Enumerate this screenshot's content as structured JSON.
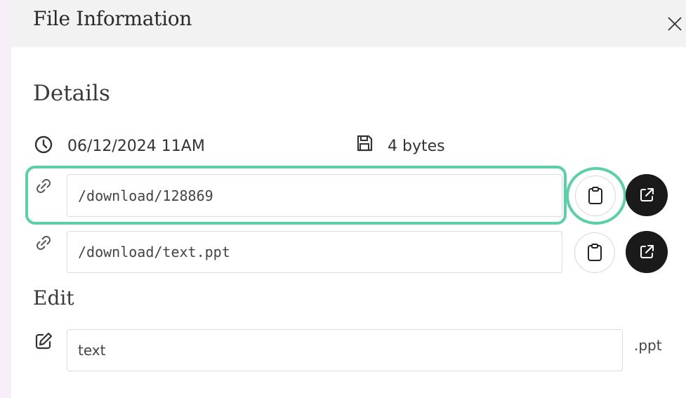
{
  "header": {
    "title": "File Information",
    "close_icon": "close-icon"
  },
  "details": {
    "heading": "Details",
    "date": "06/12/2024 11AM",
    "date_icon": "clock-icon",
    "size": "4 bytes",
    "size_icon": "save-icon"
  },
  "links": [
    {
      "value": "/download/128869",
      "link_icon": "link-icon",
      "copy_icon": "clipboard-icon",
      "open_icon": "external-link-icon"
    },
    {
      "value": "/download/text.ppt",
      "link_icon": "link-icon",
      "copy_icon": "clipboard-icon",
      "open_icon": "external-link-icon"
    }
  ],
  "edit": {
    "heading": "Edit",
    "icon": "edit-icon",
    "filename_value": "text",
    "extension": ".ppt"
  },
  "colors": {
    "highlight": "#5ccfa8",
    "header_bg": "#f2f2f2",
    "dark_button": "#1a1a1a",
    "left_strip": "#f8eefa"
  }
}
